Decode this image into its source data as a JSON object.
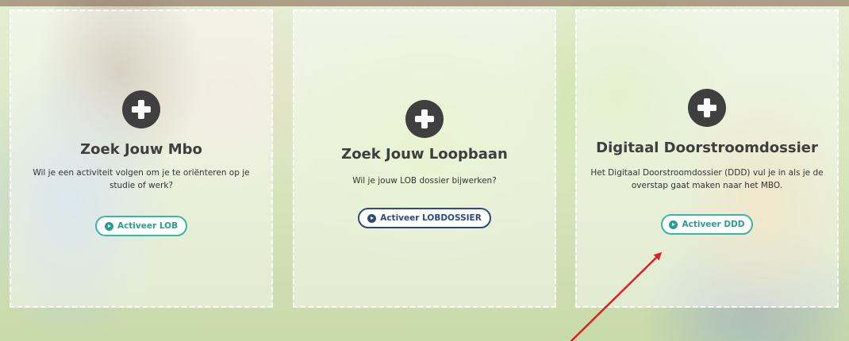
{
  "cards": [
    {
      "title": "Zoek Jouw Mbo",
      "description": "Wil je een activiteit volgen om je te oriënteren op je studie of werk?",
      "button": "Activeer LOB",
      "button_color": "#2a9d8f"
    },
    {
      "title": "Zoek Jouw Loopbaan",
      "description": "Wil je jouw LOB dossier bijwerken?",
      "button": "Activeer LOBDOSSIER",
      "button_color": "#2d4a7a"
    },
    {
      "title": "Digitaal Doorstroomdossier",
      "description": "Het Digitaal Doorstroomdossier (DDD) vul je in als je de overstap gaat maken naar het MBO.",
      "button": "Activeer DDD",
      "button_color": "#2a9d8f"
    }
  ],
  "icons": {
    "card_icon": "plus-circle-icon",
    "button_icon": "chevron-right-circle-icon"
  },
  "annotation": {
    "arrow_color": "#e02020"
  }
}
